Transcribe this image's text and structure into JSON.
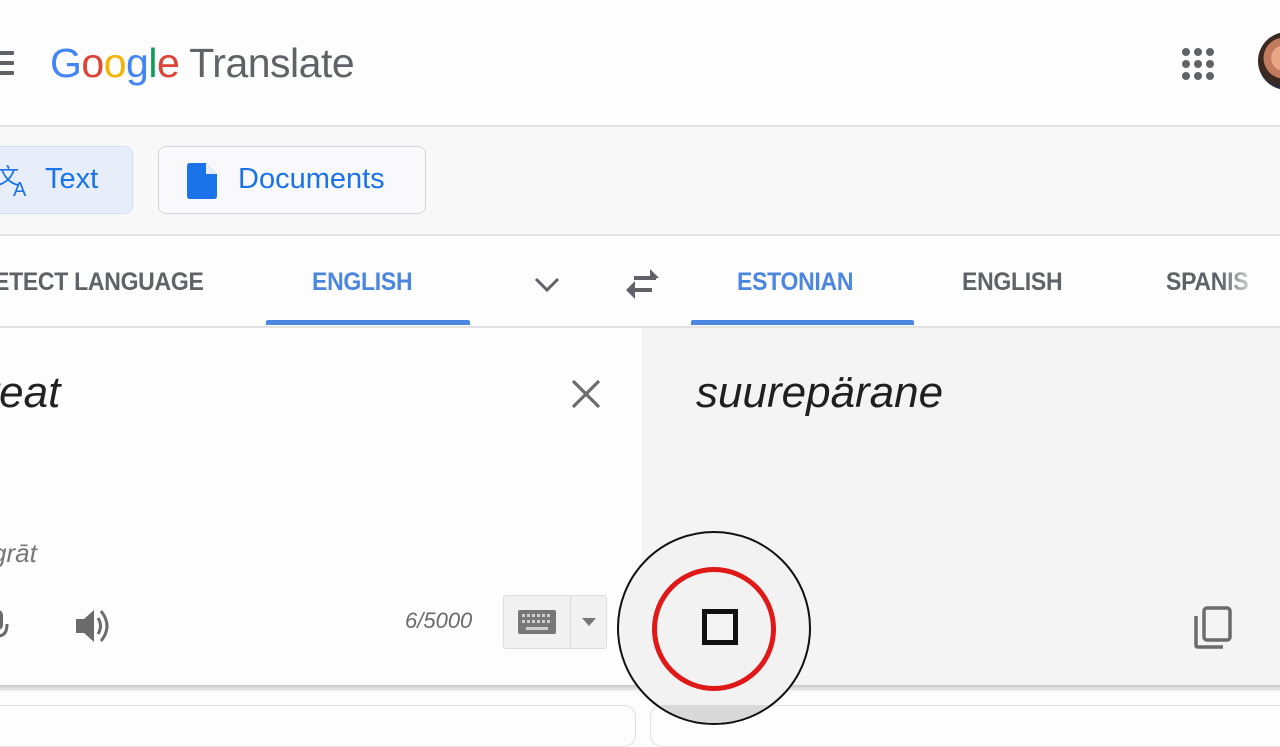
{
  "header": {
    "logo_letters": [
      {
        "char": "G",
        "color": "#4285f4"
      },
      {
        "char": "o",
        "color": "#db4437"
      },
      {
        "char": "o",
        "color": "#f4b400"
      },
      {
        "char": "g",
        "color": "#4285f4"
      },
      {
        "char": "l",
        "color": "#0f9d58"
      },
      {
        "char": "e",
        "color": "#db4437"
      }
    ],
    "product_name": "Translate",
    "menu_icon": "hamburger-menu-icon",
    "apps_icon": "google-apps-grid-icon",
    "account_icon": "user-avatar"
  },
  "modes": {
    "text_label": "Text",
    "text_icon": "translate-icon",
    "documents_label": "Documents",
    "documents_icon": "document-icon",
    "active": "Text"
  },
  "source_languages": {
    "tabs": [
      "DETECT LANGUAGE",
      "ENGLISH"
    ],
    "visible_text": [
      "ETECT LANGUAGE",
      "ENGLISH"
    ],
    "active": "ENGLISH"
  },
  "target_languages": {
    "tabs": [
      "ESTONIAN",
      "ENGLISH",
      "SPANISH"
    ],
    "visible_text": [
      "ESTONIAN",
      "ENGLISH",
      "SPANIS"
    ],
    "active": "ESTONIAN"
  },
  "source": {
    "input_value": "great",
    "visible_text": "reat",
    "transliteration": "grāt",
    "transliteration_visible": "rāt",
    "char_count": "6/5000"
  },
  "target": {
    "output_value": "suurepärane"
  },
  "colors": {
    "accent": "#4b86e0",
    "brand_blue": "#1a73e8",
    "record_ring": "#e01818",
    "tab_inactive": "#5f6368"
  },
  "overlay": {
    "state": "recording-stop",
    "icon": "stop-icon"
  }
}
